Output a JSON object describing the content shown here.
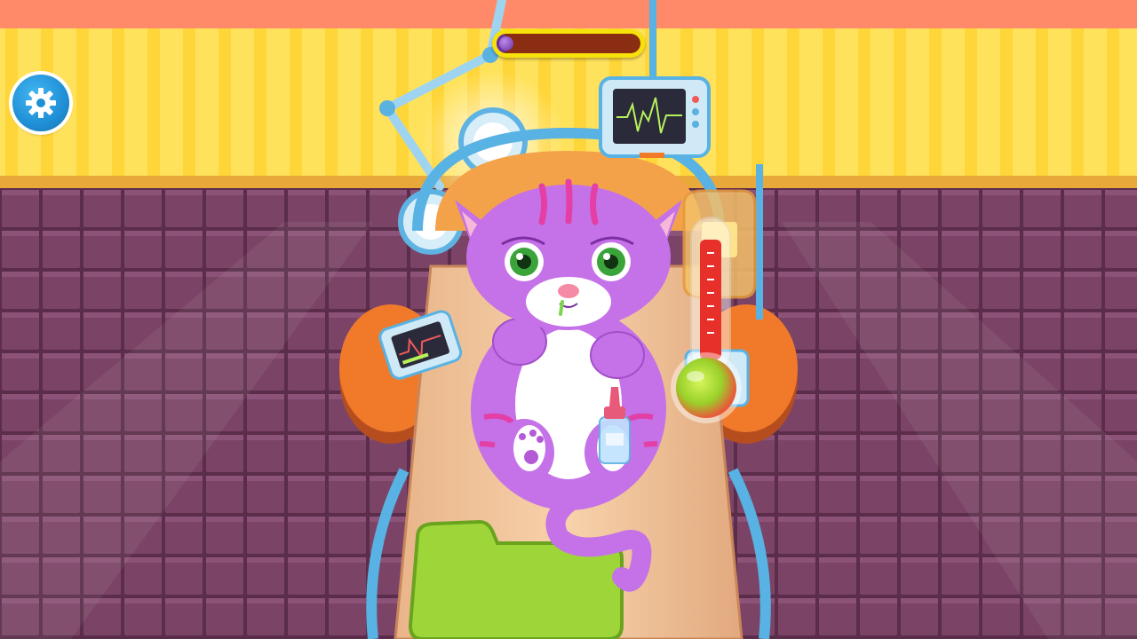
{
  "game": {
    "patient": "purple kitten",
    "progress": 0.07
  },
  "hud": {
    "settings_icon": "gear-icon"
  },
  "colors": {
    "wall": "#ffe05a",
    "floor": "#7a4466",
    "kitten": "#c571e8",
    "progress_fill": "#6a2fa3",
    "progress_track": "#8a2d12",
    "progress_border": "#f7e10a",
    "settings_button": "#1f8fd6"
  }
}
